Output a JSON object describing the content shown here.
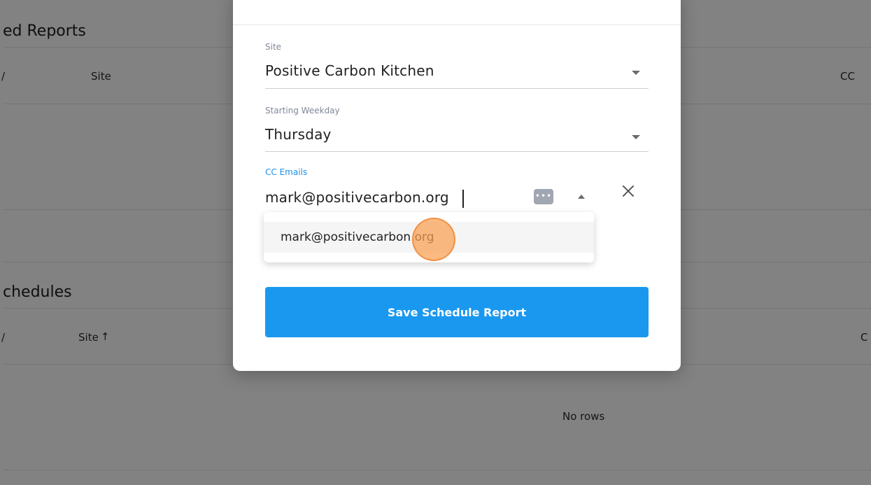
{
  "background": {
    "section1_title": "ed Reports",
    "section1_cols": [
      "/",
      "Site",
      "CC"
    ],
    "section2_title": "chedules",
    "section2_cols": [
      "/",
      "Site",
      "↑",
      "C"
    ],
    "no_rows_text": "No rows"
  },
  "modal": {
    "site": {
      "label": "Site",
      "value": "Positive Carbon Kitchen"
    },
    "weekday": {
      "label": "Starting Weekday",
      "value": "Thursday"
    },
    "cc_emails": {
      "label": "CC Emails",
      "value": "mark@positivecarbon.org"
    },
    "suggestion": "mark@positivecarbon.org",
    "save_label": "Save Schedule Report"
  },
  "icons": {
    "dropdown": "caret-down-icon",
    "collapse": "caret-up-icon",
    "password_manager": "dots-icon",
    "clear": "close-icon",
    "sort": "arrow-up-icon"
  },
  "colors": {
    "primary": "#1a98f0",
    "active_label": "#1e90e6",
    "click_marker": "#faa050"
  }
}
